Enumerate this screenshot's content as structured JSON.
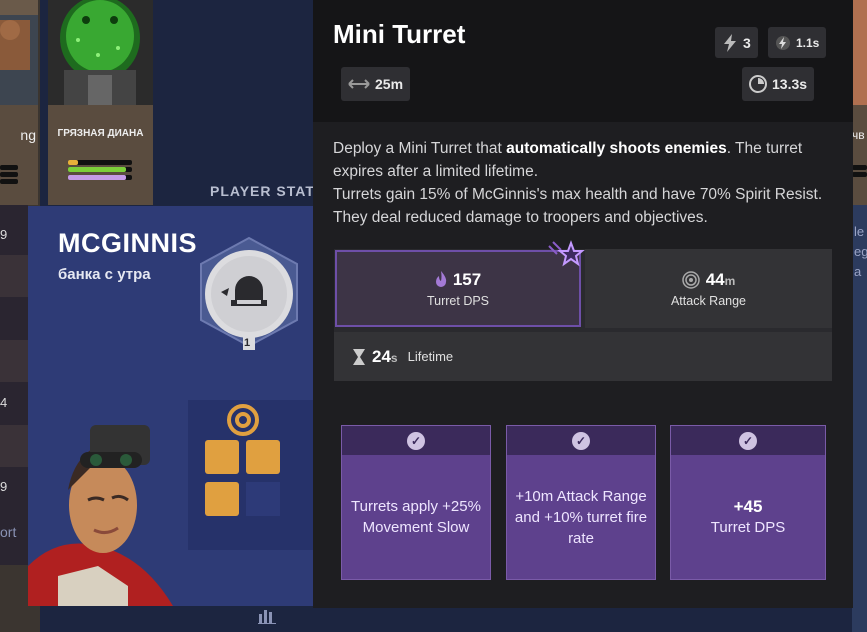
{
  "background": {
    "left_card_name": "ng",
    "diana_card_name": "ГРЯЗНАЯ ДИАНА",
    "right_card_name": "чв",
    "player_stats_label": "PLAYER STAT",
    "hero_name": "MCGINNIS",
    "hero_subtitle": "банка с утра",
    "ability_level": "1",
    "left_numbers": [
      "9",
      "4",
      "9"
    ],
    "left_port_text": "ort",
    "right_edge_texts": [
      "le",
      "eg",
      "a"
    ]
  },
  "tooltip": {
    "title": "Mini Turret",
    "charges": "3",
    "cooldown_small": "1.1s",
    "range_badge": "25m",
    "cooldown": "13.3s",
    "description_1": "Deploy a Mini Turret that ",
    "description_bold": "automatically shoots enemies",
    "description_2": ". The turret expires after a limited lifetime.",
    "description_3": "Turrets gain 15% of McGinnis's max health and have 70% Spirit Resist. They deal reduced damage to troopers and objectives.",
    "stats": {
      "dps_value": "157",
      "dps_label": "Turret DPS",
      "range_value": "44",
      "range_unit": "m",
      "range_label": "Attack Range",
      "lifetime_value": "24",
      "lifetime_unit": "s",
      "lifetime_label": "Lifetime"
    },
    "upgrades": [
      {
        "text": "Turrets apply +25% Movement Slow"
      },
      {
        "text": "+10m Attack Range and +10% turret fire rate"
      },
      {
        "big": "+45",
        "text": "Turret DPS"
      }
    ]
  },
  "icons": {
    "charges": "lightning-icon",
    "cooldown_small": "spirit-bolt-icon",
    "range": "double-arrow-icon",
    "cooldown": "cooldown-icon",
    "dps": "spirit-flame-icon",
    "range_stat": "target-icon",
    "lifetime": "hourglass-icon",
    "upgrade_check": "check-icon",
    "star": "star-icon"
  },
  "colors": {
    "tooltip_bg": "#1e1e21",
    "upgrade_purple": "#5e418d",
    "dps_highlight": "#6e4fa8",
    "item_orange": "#e0a040"
  }
}
